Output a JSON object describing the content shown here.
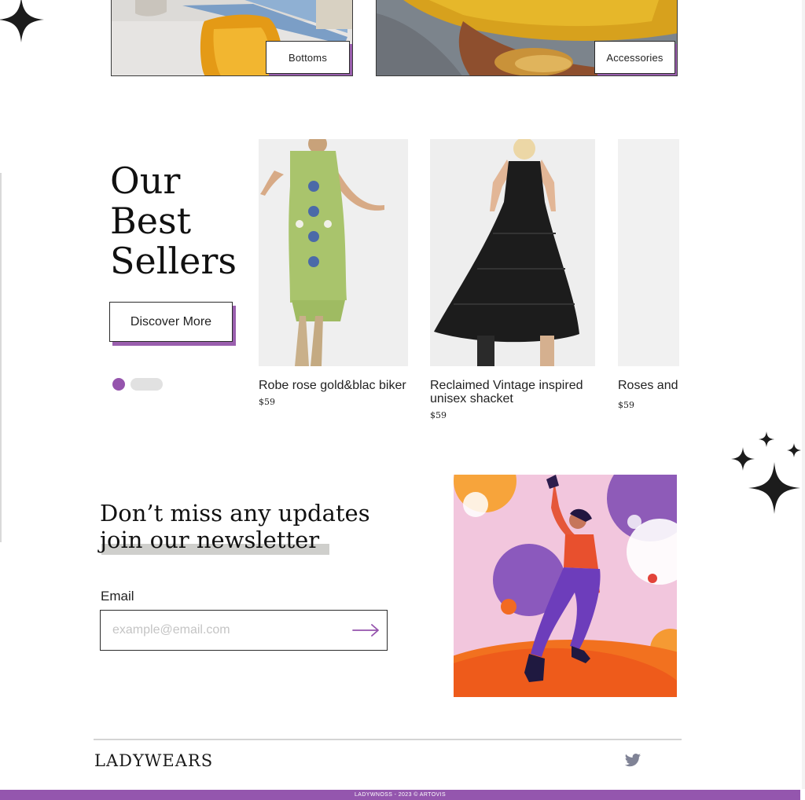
{
  "categories": [
    {
      "label": "Bottoms"
    },
    {
      "label": "Accessories"
    }
  ],
  "best_sellers": {
    "title_lines": [
      "Our",
      "Best",
      "Sellers"
    ],
    "cta_label": "Discover More",
    "products": [
      {
        "name": "Robe rose gold&blac biker",
        "price": "$59"
      },
      {
        "name": "Reclaimed Vintage inspired unisex shacket",
        "price": "$59"
      },
      {
        "name": "Roses and womens",
        "price": "$59"
      }
    ]
  },
  "newsletter": {
    "title_line1": "Don’t miss any updates",
    "title_line2": "join our newsletter",
    "email_label": "Email",
    "email_placeholder": "example@email.com"
  },
  "footer": {
    "brand": "LADYWEARS",
    "copyright": "LADYWNOSS - 2023 © ARTOVIS"
  },
  "colors": {
    "accent_purple": "#9554ad",
    "dark": "#222222"
  },
  "icons": {
    "submit": "arrow-right-icon",
    "social": "twitter-icon",
    "decor": "sparkle-icon"
  }
}
